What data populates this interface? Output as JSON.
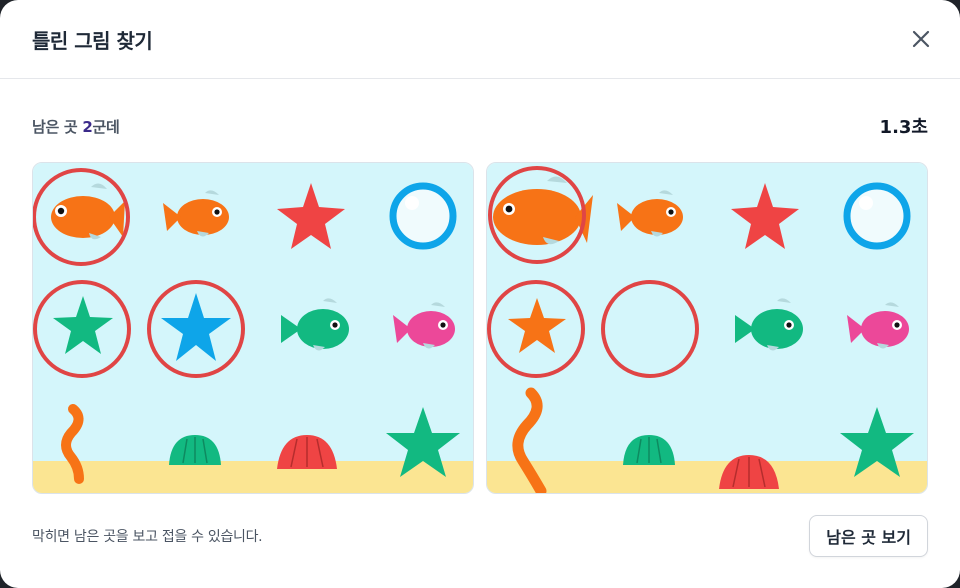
{
  "modal": {
    "title": "틀린 그림 찾기",
    "close_icon": "close-icon"
  },
  "status": {
    "remaining_prefix": "남은 곳 ",
    "remaining_count": "2",
    "remaining_suffix": "군데",
    "timer": "1.3초"
  },
  "footer": {
    "hint": "막히면 남은 곳을 보고 접을 수 있습니다.",
    "reveal_button": "남은 곳 보기"
  },
  "colors": {
    "water": "#d4f6fb",
    "sand": "#fbe592",
    "found_marker": "#e04545",
    "orange": "#f77316",
    "blue": "#0ea5e9",
    "green": "#12b981",
    "pink": "#ec4899",
    "red": "#ef4444"
  },
  "puzzle": {
    "found_differences": 3,
    "total_differences": 5,
    "left_items": [
      "fish-orange-large",
      "fish-orange",
      "star-red",
      "bubble-blue",
      "star-green",
      "star-blue",
      "fish-green",
      "fish-pink",
      "seaweed-orange",
      "shell-green",
      "shell-red",
      "star-green"
    ],
    "right_items": [
      "fish-orange-large",
      "fish-orange",
      "star-red",
      "bubble-blue",
      "star-orange",
      "empty",
      "fish-green",
      "fish-pink",
      "seaweed-orange",
      "shell-green",
      "shell-red",
      "star-green"
    ]
  }
}
